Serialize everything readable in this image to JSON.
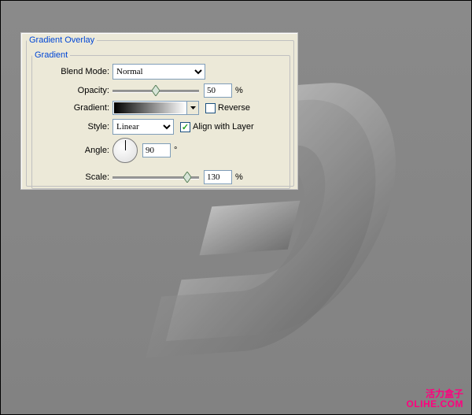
{
  "panel": {
    "outer_legend": "Gradient Overlay",
    "inner_legend": "Gradient",
    "blend_mode": {
      "label": "Blend Mode:",
      "value": "Normal"
    },
    "opacity": {
      "label": "Opacity:",
      "value": "50",
      "suffix": "%"
    },
    "gradient": {
      "label": "Gradient:"
    },
    "reverse": {
      "label": "Reverse",
      "checked": false
    },
    "style": {
      "label": "Style:",
      "value": "Linear"
    },
    "align": {
      "label": "Align with Layer",
      "checked": true
    },
    "angle": {
      "label": "Angle:",
      "value": "90",
      "suffix": "°"
    },
    "scale": {
      "label": "Scale:",
      "value": "130",
      "suffix": "%"
    }
  },
  "footer": {
    "cn": "活力盒子",
    "en": "OLIHE.COM"
  }
}
